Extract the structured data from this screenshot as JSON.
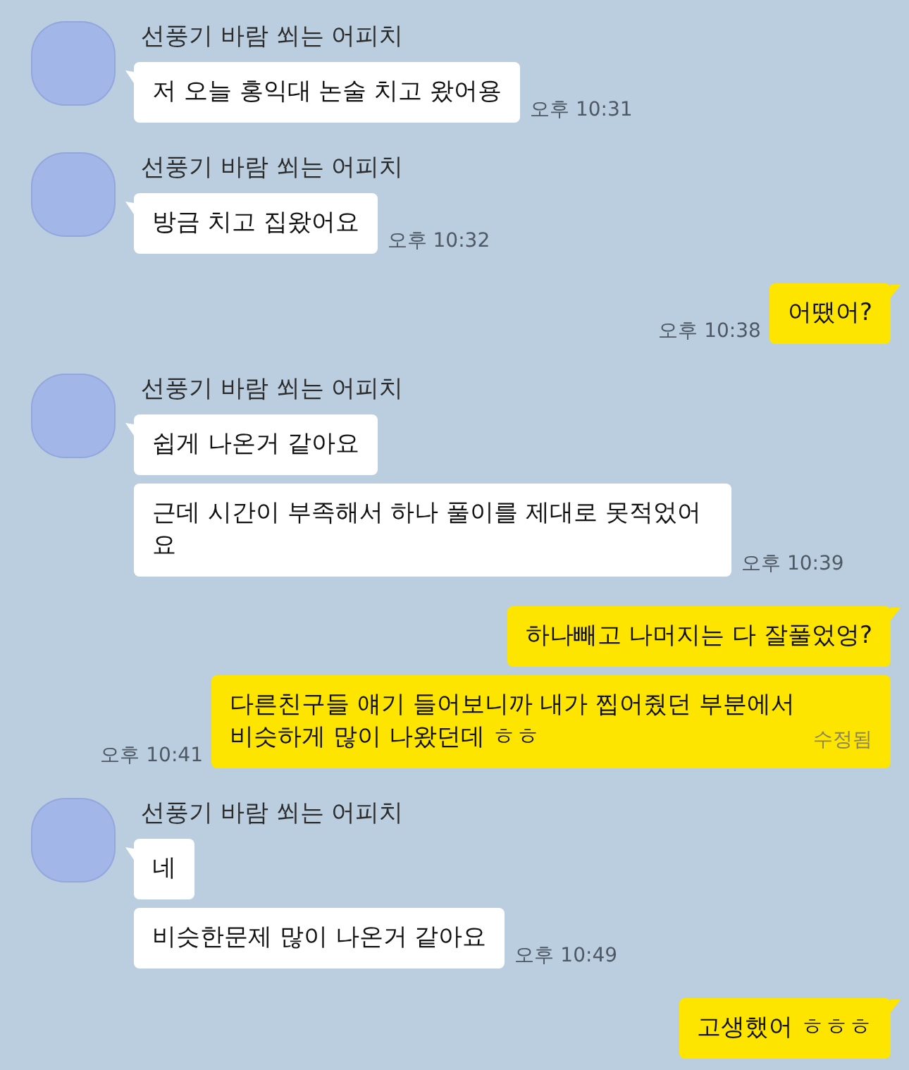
{
  "messages": [
    {
      "kind": "received",
      "sender": "선풍기 바람 쐬는 어피치",
      "bubbles": [
        {
          "text": "저 오늘 홍익대 논술 치고 왔어용",
          "time": "오후 10:31"
        }
      ]
    },
    {
      "kind": "received",
      "sender": "선풍기 바람 쐬는 어피치",
      "bubbles": [
        {
          "text": "방금 치고 집왔어요",
          "time": "오후 10:32"
        }
      ]
    },
    {
      "kind": "sent",
      "bubbles": [
        {
          "text": "어땠어?",
          "time": "오후 10:38"
        }
      ]
    },
    {
      "kind": "received",
      "sender": "선풍기 바람 쐬는 어피치",
      "bubbles": [
        {
          "text": "쉽게 나온거 같아요"
        },
        {
          "text": "근데 시간이 부족해서 하나 풀이를 제대로 못적었어요",
          "time": "오후 10:39"
        }
      ]
    },
    {
      "kind": "sent",
      "bubbles": [
        {
          "text": "하나빼고 나머지는 다 잘풀었엉?"
        },
        {
          "text": "다른친구들 얘기 들어보니까 내가 찝어줬던 부분에서 비슷하게 많이 나왔던데 ㅎㅎ",
          "edited": "수정됨",
          "time": "오후 10:41"
        }
      ]
    },
    {
      "kind": "received",
      "sender": "선풍기 바람 쐬는 어피치",
      "bubbles": [
        {
          "text": "네"
        },
        {
          "text": "비슷한문제 많이 나온거 같아요",
          "time": "오후 10:49"
        }
      ]
    },
    {
      "kind": "sent",
      "bubbles": [
        {
          "text": "고생했어 ㅎㅎㅎ"
        }
      ]
    }
  ]
}
